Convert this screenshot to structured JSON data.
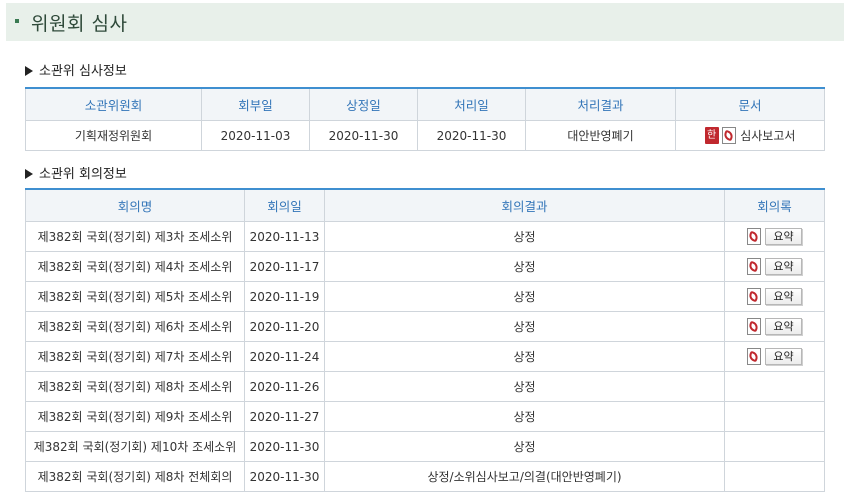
{
  "page_title": "위원회 심사",
  "subcommittee_review": {
    "heading": "소관위 심사정보",
    "columns": [
      "소관위원회",
      "회부일",
      "상정일",
      "처리일",
      "처리결과",
      "문서"
    ],
    "row": {
      "committee": "기획재정위원회",
      "referral_date": "2020-11-03",
      "presentation_date": "2020-11-30",
      "processing_date": "2020-11-30",
      "result": "대안반영폐기",
      "document": "심사보고서",
      "hwp_icon_text": "한"
    }
  },
  "meeting_info": {
    "heading": "소관위 회의정보",
    "columns": [
      "회의명",
      "회의일",
      "회의결과",
      "회의록"
    ],
    "summary_button": "요약",
    "rows": [
      {
        "name": "제382회 국회(정기회) 제3차 조세소위",
        "date": "2020-11-13",
        "result": "상정",
        "has_minutes": true
      },
      {
        "name": "제382회 국회(정기회) 제4차 조세소위",
        "date": "2020-11-17",
        "result": "상정",
        "has_minutes": true
      },
      {
        "name": "제382회 국회(정기회) 제5차 조세소위",
        "date": "2020-11-19",
        "result": "상정",
        "has_minutes": true
      },
      {
        "name": "제382회 국회(정기회) 제6차 조세소위",
        "date": "2020-11-20",
        "result": "상정",
        "has_minutes": true
      },
      {
        "name": "제382회 국회(정기회) 제7차 조세소위",
        "date": "2020-11-24",
        "result": "상정",
        "has_minutes": true
      },
      {
        "name": "제382회 국회(정기회) 제8차 조세소위",
        "date": "2020-11-26",
        "result": "상정",
        "has_minutes": false
      },
      {
        "name": "제382회 국회(정기회) 제9차 조세소위",
        "date": "2020-11-27",
        "result": "상정",
        "has_minutes": false
      },
      {
        "name": "제382회 국회(정기회) 제10차 조세소위",
        "date": "2020-11-30",
        "result": "상정",
        "has_minutes": false
      },
      {
        "name": "제382회 국회(정기회) 제8차 전체회의",
        "date": "2020-11-30",
        "result": "상정/소위심사보고/의결(대안반영폐기)",
        "has_minutes": false
      }
    ]
  },
  "colors": {
    "accent": "#3f8fd0",
    "header_bg": "#e8f0ea",
    "th_text": "#3375b8"
  }
}
